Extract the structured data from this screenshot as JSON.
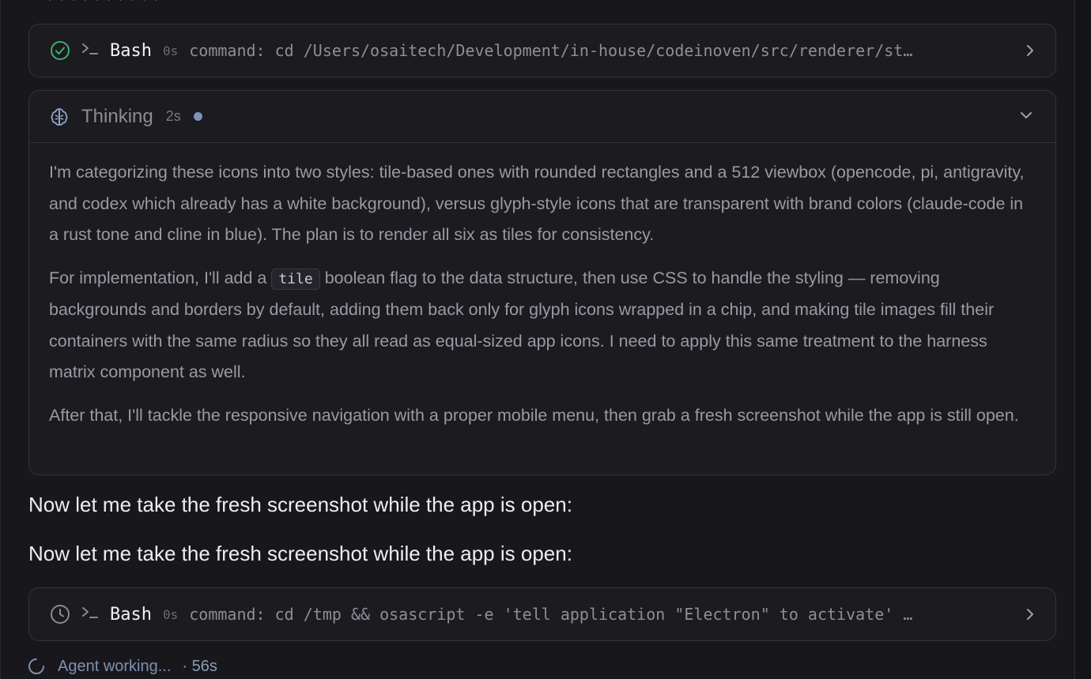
{
  "top_fragment": ", , , , , , , , , ,",
  "tool_calls": [
    {
      "status": "success",
      "status_icon": "check-circle-icon",
      "prompt_icon": "terminal-prompt-icon",
      "tool": "Bash",
      "duration": "0s",
      "command": "command: cd /Users/osaitech/Development/in-house/codeinoven/src/renderer/st…"
    },
    {
      "status": "pending",
      "status_icon": "clock-icon",
      "prompt_icon": "terminal-prompt-icon",
      "tool": "Bash",
      "duration": "0s",
      "command": "command: cd /tmp && osascript -e 'tell application \"Electron\" to activate' …"
    }
  ],
  "thinking": {
    "title": "Thinking",
    "time": "2s",
    "paragraph1": "I'm categorizing these icons into two styles: tile-based ones with rounded rectangles and a 512 viewbox (opencode, pi, antigravity, and codex which already has a white background), versus glyph-style icons that are transparent with brand colors (claude-code in a rust tone and cline in blue). The plan is to render all six as tiles for consistency.",
    "paragraph2_before": "For implementation, I'll add a ",
    "paragraph2_code": "tile",
    "paragraph2_after": " boolean flag to the data structure, then use CSS to handle the styling — removing backgrounds and borders by default, adding them back only for glyph icons wrapped in a chip, and making tile images fill their containers with the same radius so they all read as equal-sized app icons. I need to apply this same treatment to the harness matrix component as well.",
    "paragraph3": "After that, I'll tackle the responsive navigation with a proper mobile menu, then grab a fresh screenshot while the app is still open."
  },
  "messages": [
    "Now let me take the fresh screenshot while the app is open:",
    "Now let me take the fresh screenshot while the app is open:"
  ],
  "status": {
    "label": "Agent working...",
    "elapsed": "· 56s"
  },
  "colors": {
    "success": "#3fae6b",
    "accent": "#7e93b8",
    "background": "#18181c"
  }
}
